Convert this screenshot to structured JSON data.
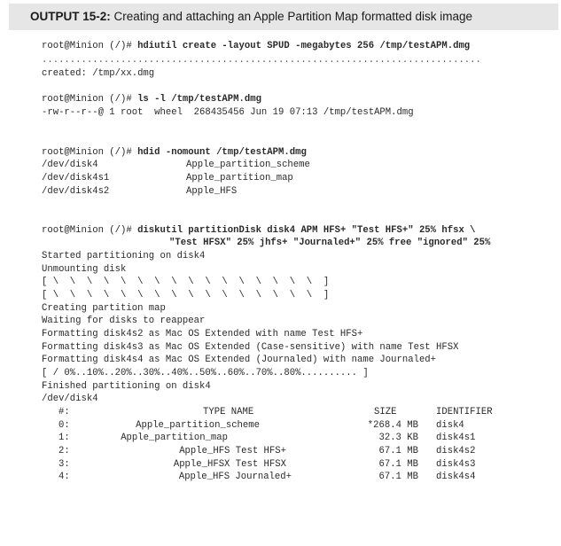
{
  "header": {
    "label": "OUTPUT 15-2:",
    "title": "Creating and attaching an Apple Partition Map formatted disk image"
  },
  "block1": {
    "prompt": "root@Minion (/)# ",
    "command": "hdiutil create -layout SPUD -megabytes 256 /tmp/testAPM.dmg",
    "progress": "..............................................................................",
    "output": "created: /tmp/xx.dmg"
  },
  "block2": {
    "prompt": "root@Minion (/)# ",
    "command": "ls -l /tmp/testAPM.dmg",
    "output": "-rw-r--r--@ 1 root  wheel  268435456 Jun 19 07:13 /tmp/testAPM.dmg"
  },
  "block3": {
    "prompt": "root@Minion (/)# ",
    "command": "hdid -nomount /tmp/testAPM.dmg",
    "rows": [
      {
        "device": "/dev/disk4",
        "name": "Apple_partition_scheme"
      },
      {
        "device": "/dev/disk4s1",
        "name": "Apple_partition_map"
      },
      {
        "device": "/dev/disk4s2",
        "name": "Apple_HFS"
      }
    ]
  },
  "block4": {
    "prompt": "root@Minion (/)# ",
    "command_line1": "diskutil partitionDisk disk4 APM HFS+ \"Test HFS+\" 25% hfsx \\",
    "command_line2": "\"Test HFSX\" 25% jhfs+ \"Journaled+\" 25% free \"ignored\" 25%",
    "output_lines": [
      "Started partitioning on disk4",
      "Unmounting disk",
      "[ \\  \\  \\  \\  \\  \\  \\  \\  \\  \\  \\  \\  \\  \\  \\  \\  ]",
      "[ \\  \\  \\  \\  \\  \\  \\  \\  \\  \\  \\  \\  \\  \\  \\  \\  ]",
      "Creating partition map",
      "Waiting for disks to reappear",
      "Formatting disk4s2 as Mac OS Extended with name Test HFS+",
      "Formatting disk4s3 as Mac OS Extended (Case-sensitive) with name Test HFSX",
      "Formatting disk4s4 as Mac OS Extended (Journaled) with name Journaled+",
      "[ / 0%..10%..20%..30%..40%..50%..60%..70%..80%.......... ]",
      "Finished partitioning on disk4",
      "/dev/disk4"
    ],
    "table": {
      "headers": {
        "num": "#:",
        "type_name": "TYPE NAME",
        "size": "SIZE",
        "identifier": "IDENTIFIER"
      },
      "rows": [
        {
          "num": "0:",
          "type_name": "Apple_partition_scheme",
          "size": "*268.4 MB",
          "identifier": "disk4"
        },
        {
          "num": "1:",
          "type_name": "Apple_partition_map",
          "size": "32.3 KB",
          "identifier": "disk4s1"
        },
        {
          "num": "2:",
          "type_name": "Apple_HFS Test HFS+",
          "size": "67.1 MB",
          "identifier": "disk4s2"
        },
        {
          "num": "3:",
          "type_name": "Apple_HFSX Test HFSX",
          "size": "67.1 MB",
          "identifier": "disk4s3"
        },
        {
          "num": "4:",
          "type_name": "Apple_HFS Journaled+",
          "size": "67.1 MB",
          "identifier": "disk4s4"
        }
      ]
    }
  }
}
